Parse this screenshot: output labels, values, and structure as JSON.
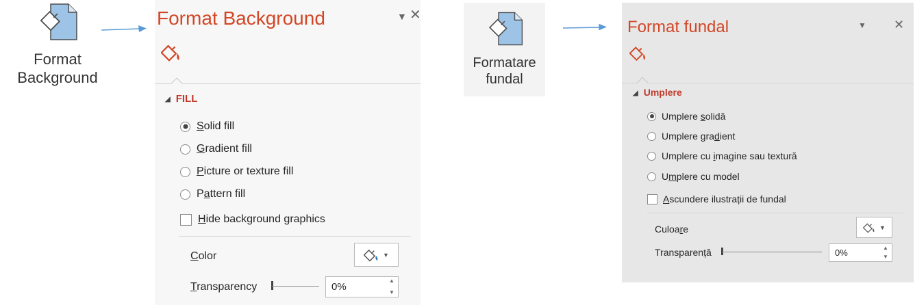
{
  "english": {
    "ribbon_button": {
      "line1": "Format",
      "line2": "Background"
    },
    "panel": {
      "title": "Format Background",
      "section": "FILL",
      "fill_options": [
        {
          "label": "Solid fill",
          "mnemonic": "S",
          "selected": true
        },
        {
          "label": "Gradient fill",
          "mnemonic": "G",
          "selected": false
        },
        {
          "label": "Picture or texture fill",
          "mnemonic": "P",
          "selected": false
        },
        {
          "label": "Pattern fill",
          "mnemonic": "a",
          "selected": false
        }
      ],
      "hide_graphics": {
        "label": "Hide background graphics",
        "checked": false
      },
      "color_label": "Color",
      "transparency_label": "Transparency",
      "transparency_value": "0%",
      "transparency_level": 0
    }
  },
  "romanian": {
    "ribbon_button": {
      "line1": "Formatare",
      "line2": "fundal"
    },
    "panel": {
      "title": "Format fundal",
      "section": "Umplere",
      "fill_options": [
        {
          "label": "Umplere solidă",
          "selected": true
        },
        {
          "label": "Umplere gradient",
          "selected": false
        },
        {
          "label": "Umplere cu imagine sau textură",
          "selected": false
        },
        {
          "label": "Umplere cu model",
          "selected": false
        }
      ],
      "hide_graphics": {
        "label": "Ascundere ilustrații de fundal",
        "checked": false
      },
      "color_label": "Culoare",
      "transparency_label": "Transparență",
      "transparency_value": "0%",
      "transparency_level": 0
    }
  },
  "icons": {
    "ribbon": "format-background-icon",
    "fill_tab": "paint-bucket-icon",
    "dropdown": "chevron-down-icon",
    "close": "close-icon",
    "arrow": "right-arrow-icon"
  },
  "colors": {
    "title": "#d24726",
    "section": "#c0392b",
    "arrow": "#5b9bd5",
    "icon_blue": "#9dc3e6",
    "en_panel_bg": "#f7f7f7",
    "ro_panel_bg": "#e7e7e7"
  }
}
